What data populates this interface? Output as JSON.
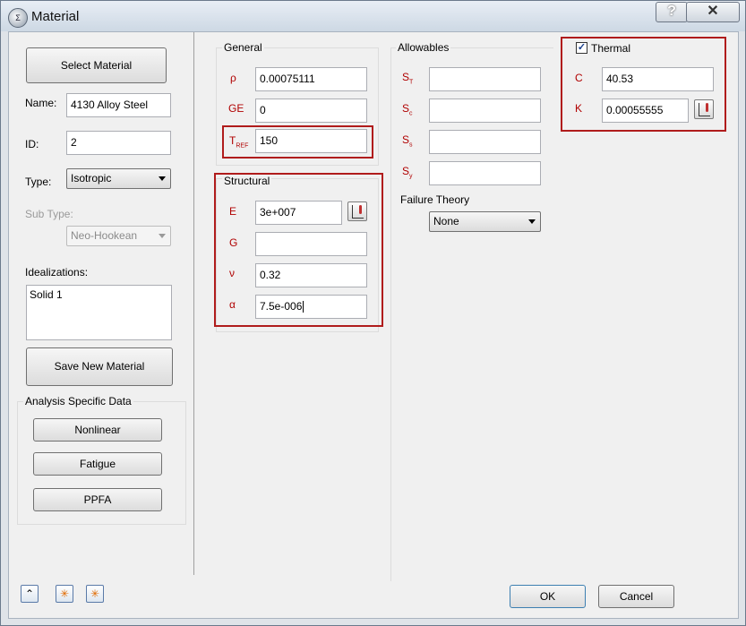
{
  "window": {
    "title": "Material",
    "help_label": "?",
    "close_label": "✕"
  },
  "left": {
    "select_material_label": "Select Material",
    "name_label": "Name:",
    "name_value": "4130 Alloy Steel",
    "id_label": "ID:",
    "id_value": "2",
    "type_label": "Type:",
    "type_value": "Isotropic",
    "subtype_label": "Sub Type:",
    "subtype_value": "Neo-Hookean",
    "idealizations_label": "Idealizations:",
    "idealizations_items": [
      "Solid 1"
    ],
    "save_new_label": "Save New Material",
    "analysis_title": "Analysis Specific Data",
    "nonlinear_label": "Nonlinear",
    "fatigue_label": "Fatigue",
    "ppfa_label": "PPFA"
  },
  "general": {
    "title": "General",
    "rho_symbol": "ρ",
    "rho_value": "0.00075111",
    "ge_symbol": "GE",
    "ge_value": "0",
    "tref_symbol": "T",
    "tref_sub": "REF",
    "tref_value": "150"
  },
  "structural": {
    "title": "Structural",
    "e_symbol": "E",
    "e_value": "3e+007",
    "g_symbol": "G",
    "g_value": "",
    "nu_symbol": "ν",
    "nu_value": "0.32",
    "alpha_symbol": "α",
    "alpha_value": "7.5e-006"
  },
  "allowables": {
    "title": "Allowables",
    "st_symbol": "S",
    "st_sub": "T",
    "st_value": "",
    "sc_symbol": "S",
    "sc_sub": "c",
    "sc_value": "",
    "ss_symbol": "S",
    "ss_sub": "s",
    "ss_value": "",
    "sy_symbol": "S",
    "sy_sub": "y",
    "sy_value": "",
    "failure_label": "Failure Theory",
    "failure_value": "None"
  },
  "thermal": {
    "title": "Thermal",
    "checked": true,
    "check_mark": "✓",
    "c_symbol": "C",
    "c_value": "40.53",
    "k_symbol": "K",
    "k_value": "0.00055555"
  },
  "footer": {
    "collapse_icon": "⌃",
    "star1_icon": "✳",
    "star2_icon": "✳",
    "ok_label": "OK",
    "cancel_label": "Cancel"
  },
  "colors": {
    "symbol": "#b00000",
    "highlight_box": "#b01c1c"
  }
}
